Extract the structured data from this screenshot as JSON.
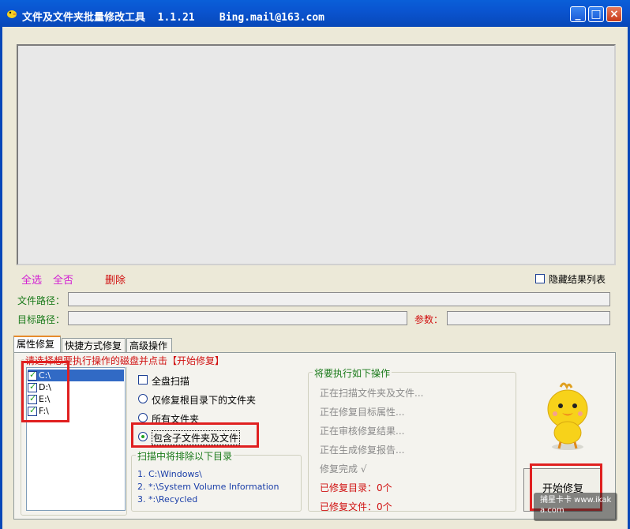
{
  "window": {
    "title": "文件及文件夹批量修改工具  1.1.21    Bing.mail@163.com",
    "min_label": "_",
    "max_label": "□",
    "close_label": "×"
  },
  "toolbar": {
    "select_all": "全选",
    "select_none": "全否",
    "delete": "删除",
    "hide_results": "隐藏结果列表"
  },
  "fields": {
    "file_path_label": "文件路径：",
    "target_path_label": "目标路径：",
    "params_label": "参数："
  },
  "tabs": [
    "属性修复",
    "快捷方式修复",
    "高级操作"
  ],
  "drives": {
    "legend": "请选择想要执行操作的磁盘并点击【开始修复】",
    "items": [
      {
        "label": "C:\\",
        "checked": true,
        "selected": true
      },
      {
        "label": "D:\\",
        "checked": true,
        "selected": false
      },
      {
        "label": "E:\\",
        "checked": true,
        "selected": false
      },
      {
        "label": "F:\\",
        "checked": true,
        "selected": false
      }
    ]
  },
  "options": {
    "full_scan": "全盘扫描",
    "root_only": "仅修复根目录下的文件夹",
    "all_folders": "所有文件夹",
    "include_subs": "包含子文件夹及文件"
  },
  "exclude": {
    "legend": "扫描中将排除以下目录",
    "items": [
      "1. C:\\Windows\\",
      "2. *:\\System Volume Information",
      "3. *:\\Recycled"
    ]
  },
  "operations": {
    "legend": "将要执行如下操作",
    "steps": [
      "正在扫描文件夹及文件...",
      "正在修复目标属性...",
      "正在审核修复结果...",
      "正在生成修复报告...",
      "修复完成 √"
    ],
    "fixed_dirs": "已修复目录：0个",
    "fixed_files": "已修复文件：0个"
  },
  "start_button": "开始修复",
  "watermark": "捕星卡卡 www.ikaka.com",
  "colors": {
    "accent_red": "#e02020",
    "title_blue": "#0a54d0",
    "link_magenta": "#d21ed2"
  }
}
